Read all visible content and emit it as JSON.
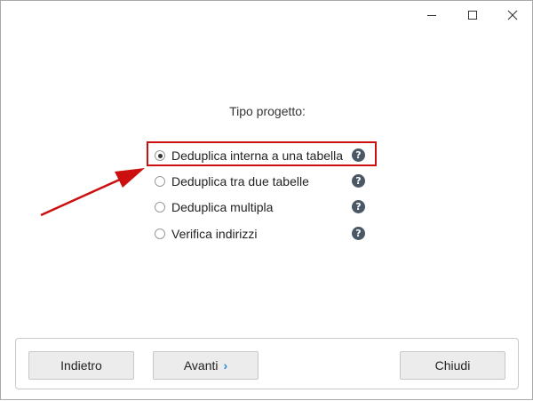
{
  "window": {
    "controls": [
      {
        "name": "minimize",
        "icon": "minimize-icon"
      },
      {
        "name": "maximize",
        "icon": "maximize-icon"
      },
      {
        "name": "close",
        "icon": "close-icon"
      }
    ]
  },
  "main": {
    "heading": "Tipo progetto:",
    "options": [
      {
        "label": "Deduplica interna a una tabella",
        "selected": true,
        "help_icon": "question-icon"
      },
      {
        "label": "Deduplica tra due tabelle",
        "selected": false,
        "help_icon": "question-icon"
      },
      {
        "label": "Deduplica multipla",
        "selected": false,
        "help_icon": "question-icon"
      },
      {
        "label": "Verifica indirizzi",
        "selected": false,
        "help_icon": "question-icon"
      }
    ],
    "help_glyph": "?",
    "annotation": {
      "highlight_color": "#cc0f0f",
      "arrow_color": "#cc0f0f"
    }
  },
  "footer": {
    "back_label": "Indietro",
    "next_label": "Avanti",
    "next_icon": "chevron-right-icon",
    "next_glyph": "›",
    "close_label": "Chiudi"
  }
}
